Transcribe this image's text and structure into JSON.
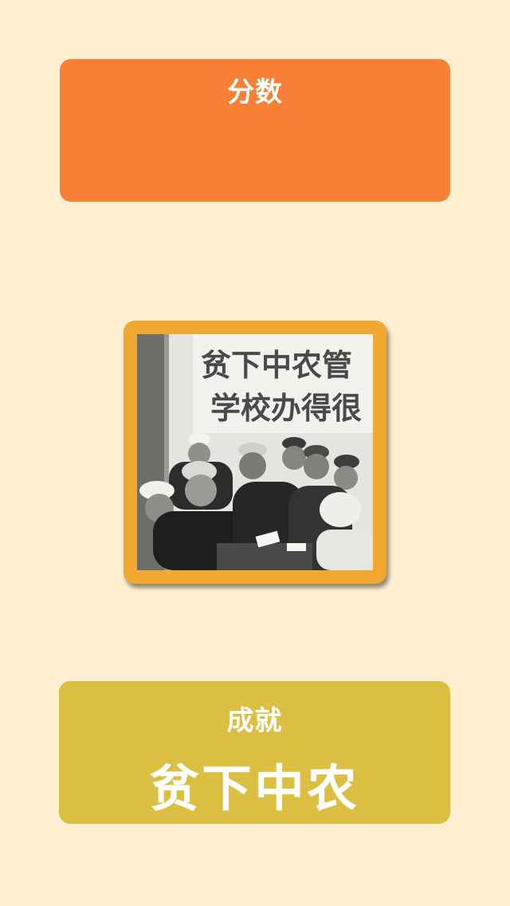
{
  "score_card": {
    "label": "分数",
    "value": ""
  },
  "photo": {
    "poster_line_1": "贫下中农管",
    "poster_line_2": "学校办得很"
  },
  "achievement_card": {
    "label": "成就",
    "title": "贫下中农"
  },
  "colors": {
    "background": "#FDEFD0",
    "score_card": "#F78036",
    "achievement_card": "#DABF42",
    "photo_frame": "#F0A830",
    "text": "#FFFFFF"
  }
}
